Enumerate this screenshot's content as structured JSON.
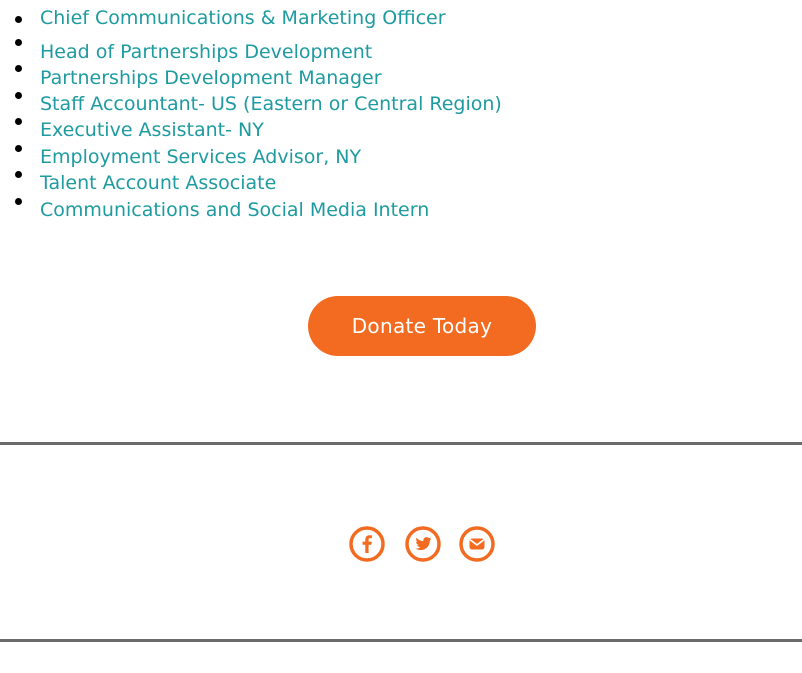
{
  "jobs": [
    {
      "label": "Chief Communications & Marketing Officer"
    },
    {
      "label": "Head of Partnerships Development"
    },
    {
      "label": "Partnerships Development Manager"
    },
    {
      "label": "Staff Accountant- US (Eastern or Central Region)"
    },
    {
      "label": "Executive Assistant- NY"
    },
    {
      "label": "Employment Services Advisor, NY"
    },
    {
      "label": "Talent Account Associate"
    },
    {
      "label": "Communications and Social Media Intern"
    }
  ],
  "donate": {
    "label": "Donate Today"
  },
  "social": [
    {
      "icon": "facebook-icon"
    },
    {
      "icon": "twitter-icon"
    },
    {
      "icon": "email-icon"
    }
  ],
  "colors": {
    "link": "#1e9ba0",
    "accent": "#f26b21",
    "divider": "#6b6b6b"
  }
}
